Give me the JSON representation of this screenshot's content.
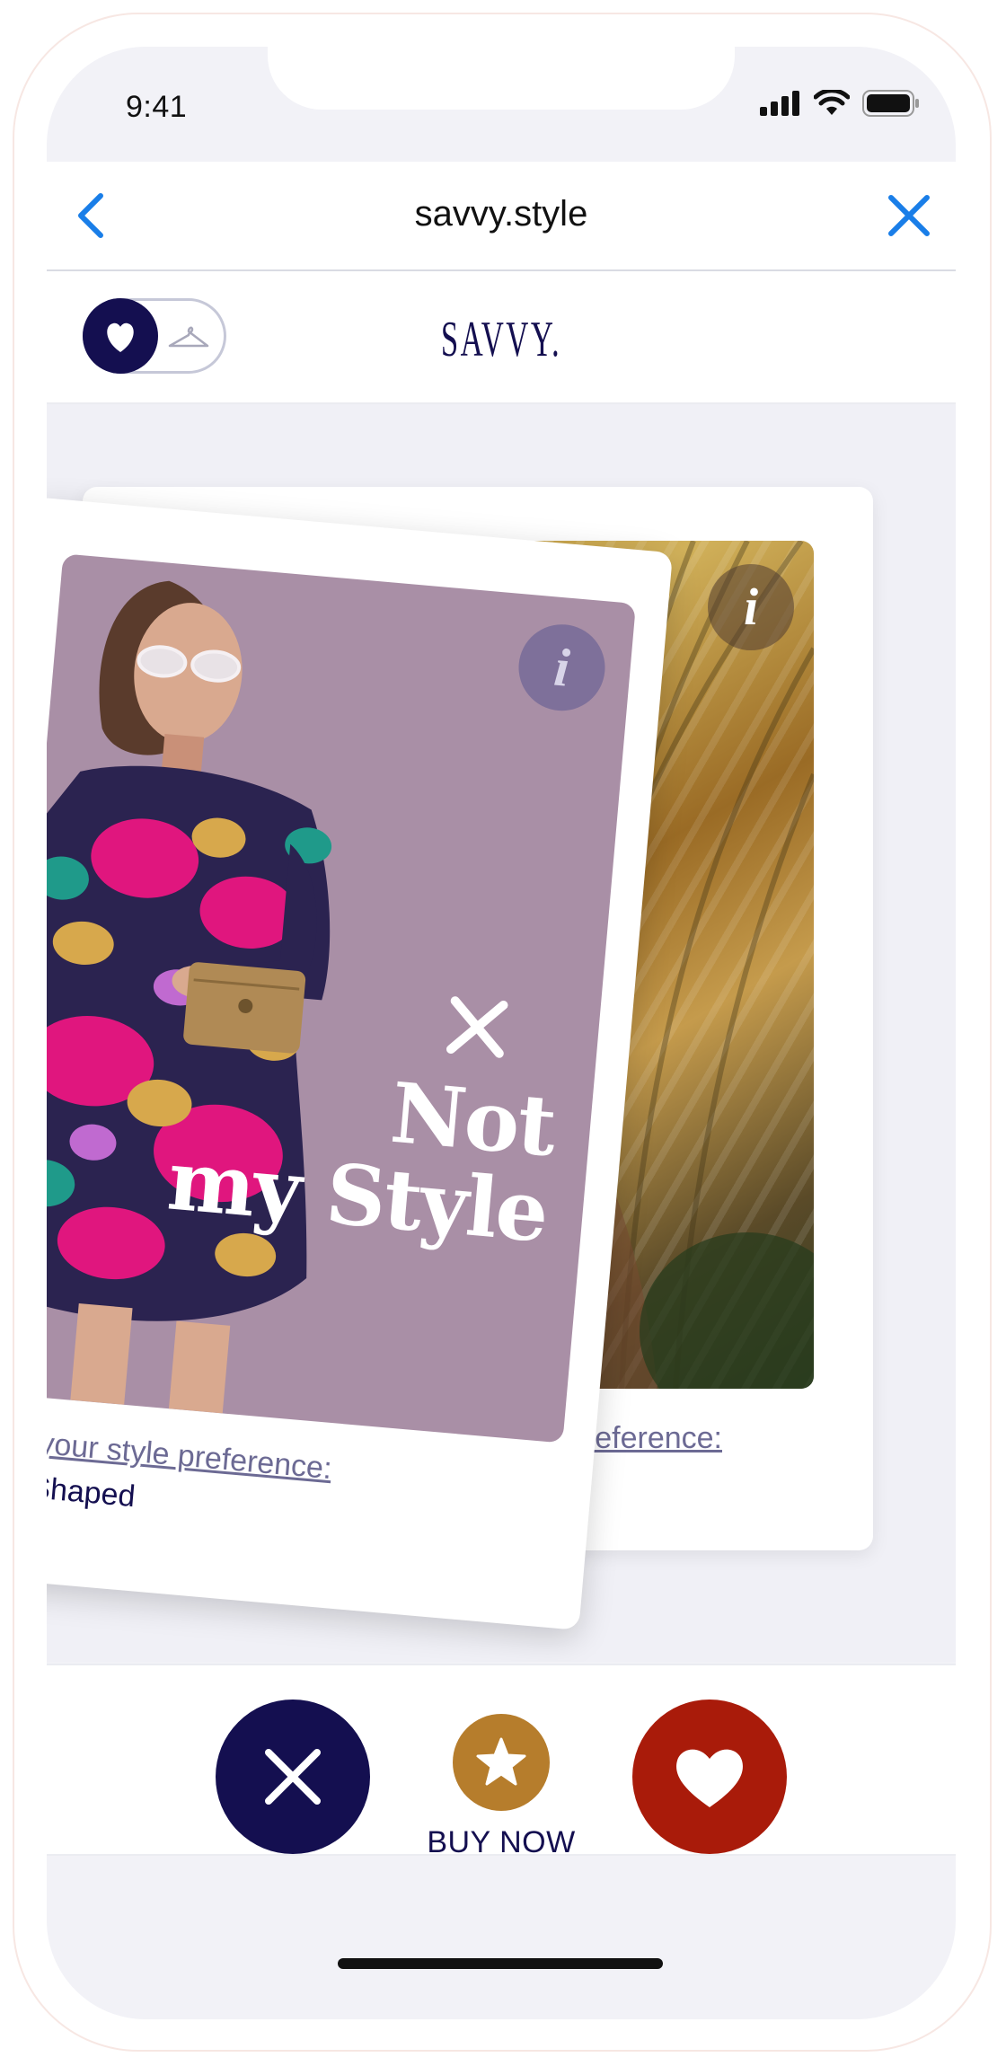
{
  "status_bar": {
    "time": "9:41",
    "icons": [
      "cellular-signal-icon",
      "wifi-icon",
      "battery-icon"
    ]
  },
  "browser": {
    "title": "savvy.style",
    "back_icon": "chevron-left-icon",
    "close_icon": "close-icon"
  },
  "header": {
    "brand": "SAVVY.",
    "toggle": {
      "active": "heart-icon",
      "inactive": "hanger-icon"
    }
  },
  "cards": {
    "back": {
      "info_label": "i",
      "caption": "preference:"
    },
    "front": {
      "info_label": "i",
      "stamp_line1": "Not",
      "stamp_line2": "my Style",
      "caption": "d on your style preference:",
      "caption_value": "lass Shaped"
    }
  },
  "actions": {
    "reject_icon": "close-icon",
    "buy_icon": "star-icon",
    "buy_label": "BUY NOW",
    "like_icon": "heart-icon"
  },
  "colors": {
    "navy": "#140f50",
    "gold": "#b67d2c",
    "red": "#a91b0a",
    "ios_blue": "#1a7ee8"
  }
}
